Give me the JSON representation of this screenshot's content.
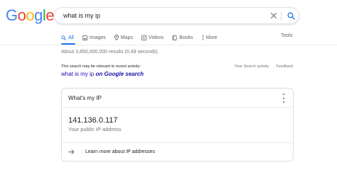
{
  "logo": {
    "letters": [
      "G",
      "o",
      "o",
      "g",
      "l",
      "e"
    ],
    "colors": [
      "#4285f4",
      "#ea4335",
      "#fbbc05",
      "#4285f4",
      "#34a853",
      "#ea4335"
    ]
  },
  "search": {
    "query": "what is my ip"
  },
  "tabs": [
    {
      "label": "All",
      "icon": "search-icon",
      "active": true
    },
    {
      "label": "Images",
      "icon": "image-icon",
      "active": false
    },
    {
      "label": "Maps",
      "icon": "map-pin-icon",
      "active": false
    },
    {
      "label": "Videos",
      "icon": "video-icon",
      "active": false
    },
    {
      "label": "Books",
      "icon": "book-icon",
      "active": false
    },
    {
      "label": "More",
      "icon": "more-dots-icon",
      "active": false
    }
  ],
  "tools_label": "Tools",
  "results_stats": "About 3,850,000,000 results (0.49 seconds)",
  "activity": {
    "notice": "This search may be relevant to recent activity:",
    "your_activity": "Your Search activity",
    "feedback": "Feedback",
    "query_text": "what is my ip",
    "query_suffix": "on Google search"
  },
  "card": {
    "title": "What's my IP",
    "ip": "141.136.0.117",
    "ip_label": "Your public IP address",
    "learn_more": "Learn more about IP addresses"
  },
  "colors": {
    "accent": "#1a73e8",
    "link": "#1a0dab"
  }
}
